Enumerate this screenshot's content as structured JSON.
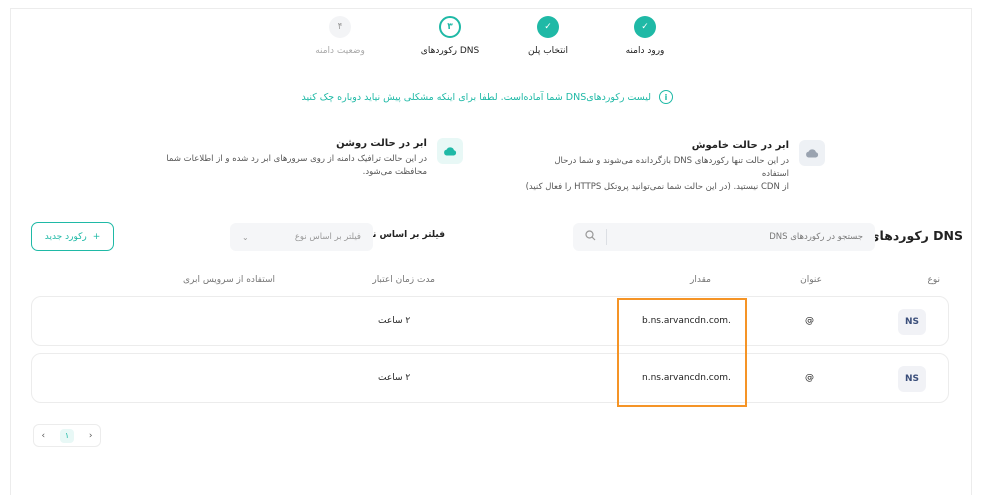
{
  "stepper": {
    "steps": [
      {
        "label": "ورود دامنه",
        "marker": "✓",
        "state": "done"
      },
      {
        "label": "انتخاب پلن",
        "marker": "✓",
        "state": "done"
      },
      {
        "label": "رکوردهای DNS",
        "marker": "۳",
        "state": "current"
      },
      {
        "label": "وضعیت دامنه",
        "marker": "۴",
        "state": "pending"
      }
    ]
  },
  "notice": {
    "icon": "info-icon",
    "text": "لیست رکوردهایDNS شما آماده‌است. لطفا برای اینکه مشکلی پیش نیاید دوباره چک کنید"
  },
  "cloud_off": {
    "title": "ابر در حالت خاموش",
    "desc_line1": "در این حالت تنها رکوردهای DNS بازگردانده می‌شوند و شما درحال استفاده",
    "desc_line2": "از CDN نیستید. (در این حالت شما نمی‌توانید پروتکل HTTPS را فعال کنید)"
  },
  "cloud_on": {
    "title": "ابر در حالت روشن",
    "desc_line1": "در این حالت ترافیک دامنه از روی سرورهای ابر رد شده و از اطلاعات شما",
    "desc_line2": "محافظت می‌شود."
  },
  "dns": {
    "title": "رکوردهای DNS",
    "search_placeholder": "جستجو در رکوردهای DNS",
    "filter_label": "فیلتر بر اساس نوع",
    "filter_placeholder": "فیلتر بر اساس نوع",
    "new_button": "رکورد جدید",
    "new_button_icon": "+"
  },
  "table": {
    "headers": {
      "type": "نوع",
      "name": "عنوان",
      "value": "مقدار",
      "ttl": "مدت زمان اعتبار",
      "cloud": "استفاده از سرویس ابری"
    },
    "rows": [
      {
        "type": "NS",
        "name": "@",
        "value": "b.ns.arvancdn.com.",
        "ttl": "۲ ساعت"
      },
      {
        "type": "NS",
        "name": "@",
        "value": "n.ns.arvancdn.com.",
        "ttl": "۲ ساعت"
      }
    ]
  },
  "pagination": {
    "prev": "‹",
    "current": "۱",
    "next": "›"
  },
  "colors": {
    "accent": "#1fb9a6",
    "highlight": "#f59426"
  }
}
